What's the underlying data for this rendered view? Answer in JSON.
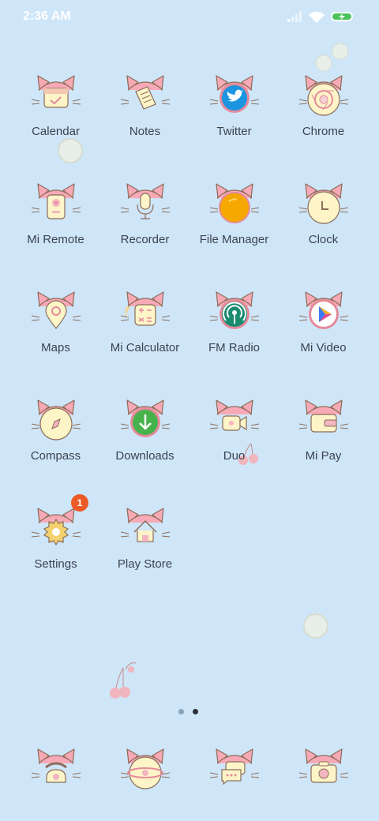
{
  "status_bar": {
    "time": "2:36 AM",
    "icons": [
      "signal-icon",
      "wifi-icon",
      "battery-charging-icon"
    ]
  },
  "colors": {
    "background": "#cfe6f8",
    "cat_ear": "#f7a9b6",
    "cat_face": "#fdf4c8",
    "outline": "#8a6d5a",
    "badge": "#ec5a28"
  },
  "apps": [
    {
      "label": "Calendar",
      "icon": "calendar-icon"
    },
    {
      "label": "Notes",
      "icon": "notes-icon"
    },
    {
      "label": "Twitter",
      "icon": "twitter-icon"
    },
    {
      "label": "Chrome",
      "icon": "chrome-icon"
    },
    {
      "label": "Mi Remote",
      "icon": "remote-icon"
    },
    {
      "label": "Recorder",
      "icon": "microphone-icon"
    },
    {
      "label": "File Manager",
      "icon": "folder-icon"
    },
    {
      "label": "Clock",
      "icon": "clock-icon"
    },
    {
      "label": "Maps",
      "icon": "map-pin-icon"
    },
    {
      "label": "Mi Calculator",
      "icon": "calculator-icon"
    },
    {
      "label": "FM Radio",
      "icon": "radio-icon"
    },
    {
      "label": "Mi Video",
      "icon": "play-icon"
    },
    {
      "label": "Compass",
      "icon": "compass-icon"
    },
    {
      "label": "Downloads",
      "icon": "download-icon"
    },
    {
      "label": "Duo",
      "icon": "video-camera-icon"
    },
    {
      "label": "Mi Pay",
      "icon": "wallet-icon"
    },
    {
      "label": "Settings",
      "icon": "gear-icon",
      "badge": "1"
    },
    {
      "label": "Play Store",
      "icon": "home-icon"
    }
  ],
  "page_indicator": {
    "pages": 2,
    "current": 2
  },
  "dock": [
    {
      "icon": "phone-icon"
    },
    {
      "icon": "browser-globe-icon"
    },
    {
      "icon": "messages-icon"
    },
    {
      "icon": "camera-icon"
    }
  ]
}
